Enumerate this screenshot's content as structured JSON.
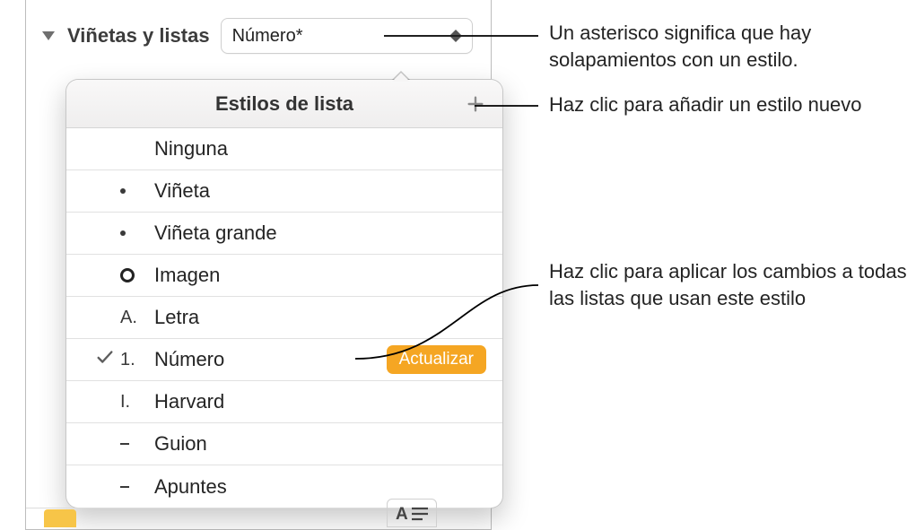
{
  "header": {
    "section_label": "Viñetas y listas",
    "dropdown_value": "Número*"
  },
  "popover": {
    "title": "Estilos de lista",
    "update_button": "Actualizar",
    "items": [
      {
        "marker_type": "none",
        "label": "Ninguna",
        "checked": false,
        "update": false
      },
      {
        "marker_type": "bullet",
        "label": "Viñeta",
        "checked": false,
        "update": false
      },
      {
        "marker_type": "bullet",
        "label": "Viñeta grande",
        "checked": false,
        "update": false
      },
      {
        "marker_type": "ring",
        "label": "Imagen",
        "checked": false,
        "update": false
      },
      {
        "marker_type": "text",
        "marker_text": "A.",
        "label": "Letra",
        "checked": false,
        "update": false
      },
      {
        "marker_type": "text",
        "marker_text": "1.",
        "label": "Número",
        "checked": true,
        "update": true
      },
      {
        "marker_type": "text",
        "marker_text": "I.",
        "label": "Harvard",
        "checked": false,
        "update": false
      },
      {
        "marker_type": "dash",
        "label": "Guion",
        "checked": false,
        "update": false
      },
      {
        "marker_type": "dash",
        "label": "Apuntes",
        "checked": false,
        "update": false
      }
    ]
  },
  "callouts": {
    "asterisk": "Un asterisco significa que hay solapamientos con un estilo.",
    "add": "Haz clic para añadir un estilo nuevo",
    "update": "Haz clic para aplicar los cambios a todas las listas que usan este estilo"
  }
}
